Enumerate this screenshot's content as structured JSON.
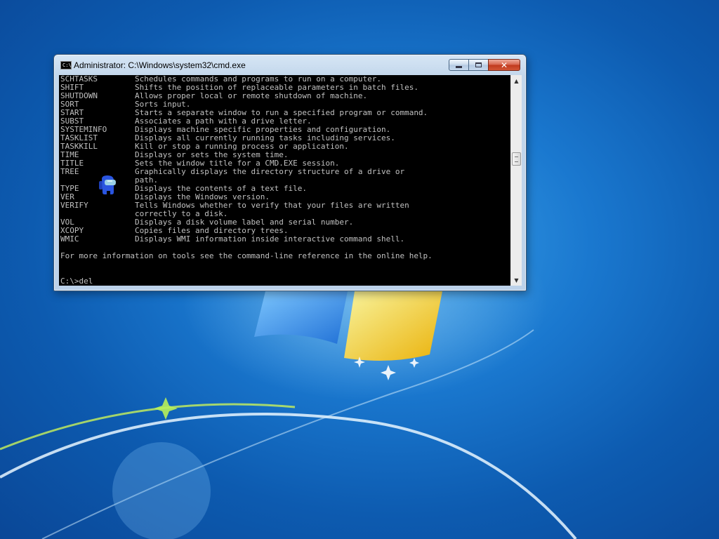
{
  "window": {
    "title": "Administrator: C:\\Windows\\system32\\cmd.exe",
    "icon_label": "C:\\",
    "icon": "cmd-icon",
    "buttons": {
      "minimize": "minimize-icon",
      "maximize": "maximize-icon",
      "close": "close-icon",
      "close_glyph": "✕"
    }
  },
  "console": {
    "lines": [
      "SCHTASKS        Schedules commands and programs to run on a computer.",
      "SHIFT           Shifts the position of replaceable parameters in batch files.",
      "SHUTDOWN        Allows proper local or remote shutdown of machine.",
      "SORT            Sorts input.",
      "START           Starts a separate window to run a specified program or command.",
      "SUBST           Associates a path with a drive letter.",
      "SYSTEMINFO      Displays machine specific properties and configuration.",
      "TASKLIST        Displays all currently running tasks including services.",
      "TASKKILL        Kill or stop a running process or application.",
      "TIME            Displays or sets the system time.",
      "TITLE           Sets the window title for a CMD.EXE session.",
      "TREE            Graphically displays the directory structure of a drive or",
      "                path.",
      "TYPE            Displays the contents of a text file.",
      "VER             Displays the Windows version.",
      "VERIFY          Tells Windows whether to verify that your files are written",
      "                correctly to a disk.",
      "VOL             Displays a disk volume label and serial number.",
      "XCOPY           Copies files and directory trees.",
      "WMIC            Displays WMI information inside interactive command shell.",
      "",
      "For more information on tools see the command-line reference in the online help."
    ],
    "prompt": "C:\\>del",
    "text_color": "#c0c0c0",
    "background_color": "#000000"
  },
  "scrollbar": {
    "up_glyph": "▲",
    "down_glyph": "▼"
  },
  "desktop": {
    "wallpaper": "windows-7-default",
    "sprite": "crewmate-icon"
  }
}
